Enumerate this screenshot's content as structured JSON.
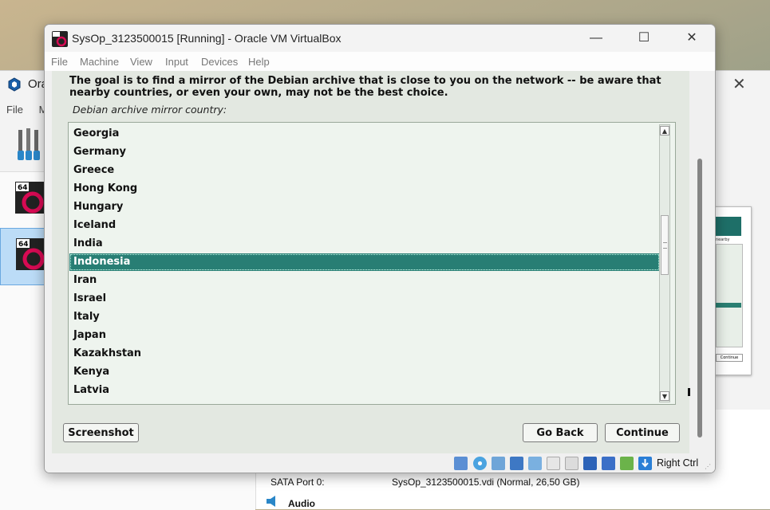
{
  "manager": {
    "title": "Ora",
    "menu": [
      "File",
      "M"
    ],
    "vm_badges": [
      "64",
      "64"
    ],
    "storage_label": "SATA Port 0:",
    "storage_value": "SysOp_3123500015.vdi (Normal, 26,50 GB)",
    "audio_label": "Audio",
    "preview_text": "nearby",
    "preview_button": "Continue"
  },
  "window": {
    "title": "SysOp_3123500015 [Running] - Oracle VM VirtualBox",
    "controls": {
      "minimize": "—",
      "maximize": "☐",
      "close": "✕"
    },
    "menu": [
      "File",
      "Machine",
      "View",
      "Input",
      "Devices",
      "Help"
    ]
  },
  "installer": {
    "prompt": "The goal is to find a mirror of the Debian archive that is close to you on the network -- be aware that nearby countries, or even your own, may not be the best choice.",
    "label": "Debian archive mirror country:",
    "countries": [
      "Georgia",
      "Germany",
      "Greece",
      "Hong Kong",
      "Hungary",
      "Iceland",
      "India",
      "Indonesia",
      "Iran",
      "Israel",
      "Italy",
      "Japan",
      "Kazakhstan",
      "Kenya",
      "Latvia"
    ],
    "selected": "Indonesia",
    "buttons": {
      "screenshot": "Screenshot",
      "go_back": "Go Back",
      "continue": "Continue"
    }
  },
  "statusbar": {
    "icons": [
      "hard-disk-icon",
      "optical-drive-icon",
      "audio-icon",
      "network-icon",
      "usb-icon",
      "shared-folders-icon",
      "display-icon",
      "recording-icon",
      "vm-state-icon",
      "cpu-icon",
      "mouse-integration-icon",
      "keyboard-capture-icon"
    ],
    "host_key": "Right Ctrl"
  },
  "colors": {
    "selection": "#287e74",
    "installer_bg": "#e3e8e1",
    "list_bg": "#eef4ee"
  }
}
